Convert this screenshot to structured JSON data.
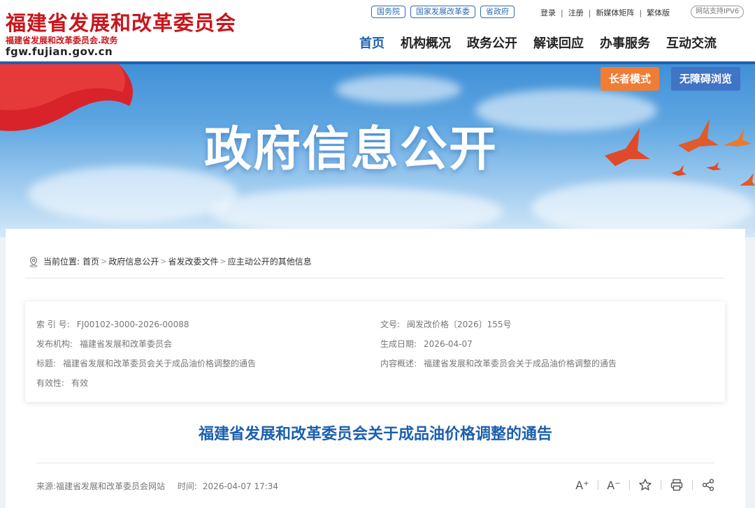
{
  "header": {
    "title": "福建省发展和改革委员会",
    "subtitle": "福建省发展和改革委员会.政务",
    "domain": "fgw.fujian.gov.cn",
    "top_pills": [
      "国务院",
      "国家发展改革委",
      "省政府"
    ],
    "user_links": [
      "登录",
      "注册",
      "新媒体矩阵",
      "繁体版"
    ],
    "ipv6": "网站支持IPV6",
    "nav": [
      "首页",
      "机构概况",
      "政务公开",
      "解读回应",
      "办事服务",
      "互动交流"
    ]
  },
  "banner": {
    "title": "政府信息公开",
    "elder_mode": "长者模式",
    "accessible": "无障碍浏览"
  },
  "breadcrumb": {
    "prefix": "当前位置:",
    "items": [
      "首页",
      "政府信息公开",
      "省发改委文件",
      "应主动公开的其他信息"
    ]
  },
  "meta": {
    "index_label": "索 引 号:",
    "index_value": "FJ00102-3000-2026-00088",
    "doc_no_label": "文号:",
    "doc_no_value": "闽发改价格〔2026〕155号",
    "publisher_label": "发布机构:",
    "publisher_value": "福建省发展和改革委员会",
    "date_label": "生成日期:",
    "date_value": "2026-04-07",
    "title_label": "标题:",
    "title_value": "福建省发展和改革委员会关于成品油价格调整的通告",
    "summary_label": "内容概述:",
    "summary_value": "福建省发展和改革委员会关于成品油价格调整的通告",
    "validity_label": "有效性:",
    "validity_value": "有效"
  },
  "document": {
    "title": "福建省发展和改革委员会关于成品油价格调整的通告",
    "source": "来源:福建省发展和改革委员会网站",
    "time_label": "时间:",
    "time_value": "2026-04-07 17:34"
  },
  "tools": {
    "font_up": "A⁺",
    "font_down": "A⁻"
  },
  "colors": {
    "brand_red": "#c8161d",
    "nav_blue": "#1b5fae",
    "elder_orange": "#f07d35",
    "access_blue": "#3f74c6"
  }
}
